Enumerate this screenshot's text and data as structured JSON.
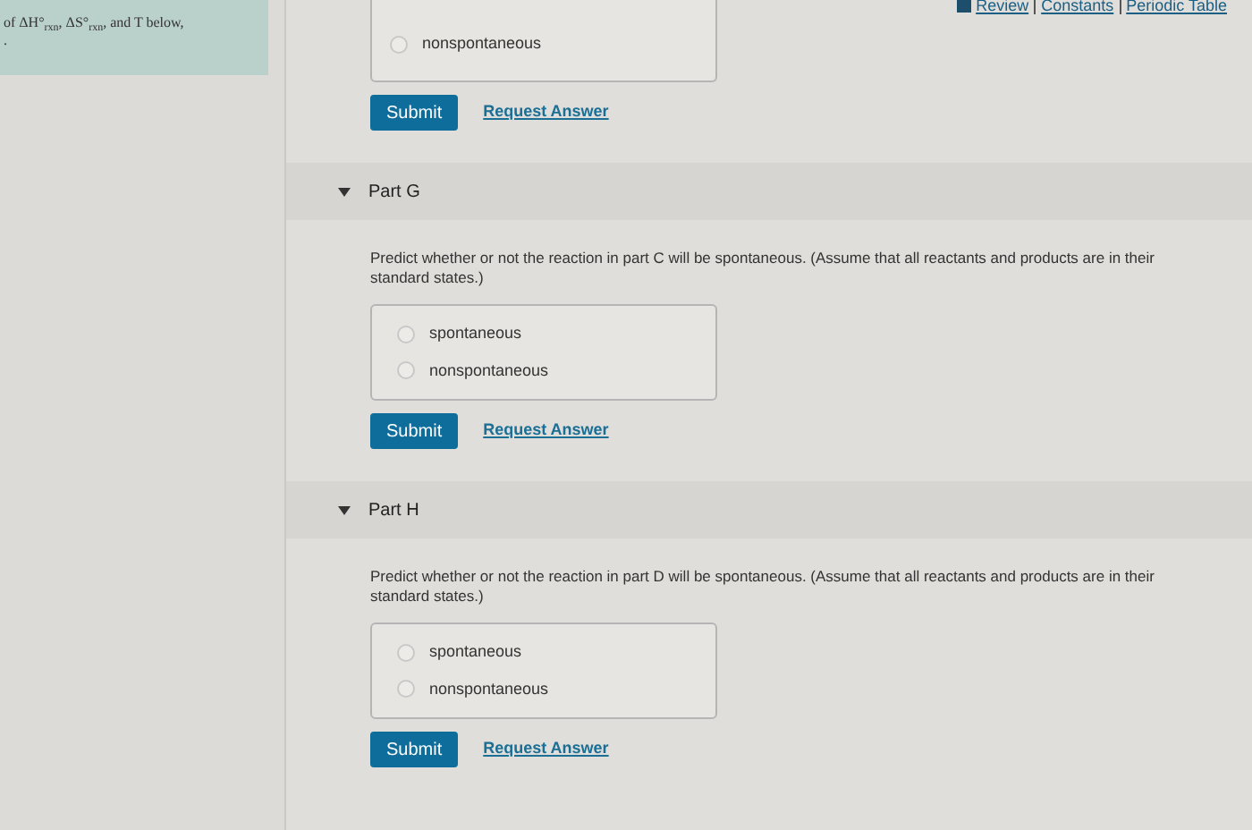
{
  "context": {
    "lines": [
      "of ΔH°$_{rxn}$, ΔS°$_{rxn}$, and T below,",
      "."
    ]
  },
  "top_links": [
    "Review",
    "Constants",
    "Periodic Table"
  ],
  "previous_part": {
    "options": [
      {
        "label": "nonspontaneous",
        "selected": false
      }
    ],
    "submit": "Submit",
    "request": "Request Answer"
  },
  "parts": [
    {
      "title": "Part G",
      "expanded": true,
      "prompt": "Predict whether or not the reaction in part C will be spontaneous. (Assume that all reactants and products are in their standard states.)",
      "options": [
        {
          "label": "spontaneous",
          "selected": false
        },
        {
          "label": "nonspontaneous",
          "selected": false
        }
      ],
      "submit": "Submit",
      "request": "Request Answer"
    },
    {
      "title": "Part H",
      "expanded": true,
      "prompt": "Predict whether or not the reaction in part D will be spontaneous. (Assume that all reactants and products are in their standard states.)",
      "options": [
        {
          "label": "spontaneous",
          "selected": false
        },
        {
          "label": "nonspontaneous",
          "selected": false
        }
      ],
      "submit": "Submit",
      "request": "Request Answer"
    }
  ]
}
